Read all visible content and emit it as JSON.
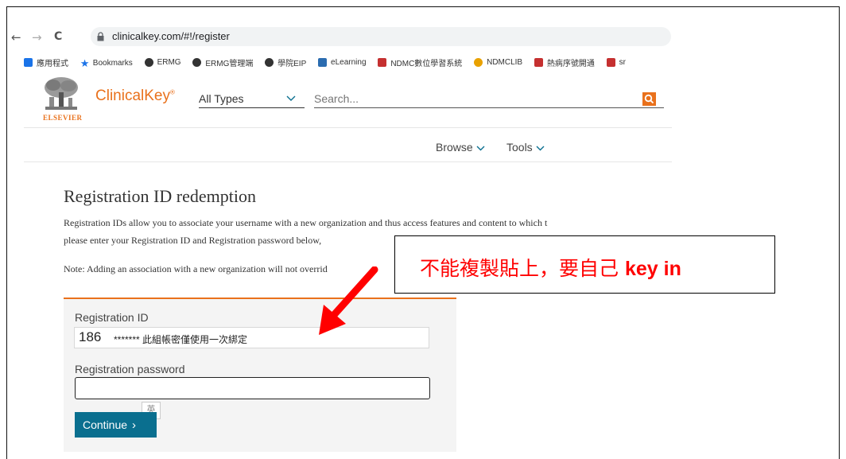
{
  "browser": {
    "back_glyph": "←",
    "forward_glyph": "→",
    "reload_glyph": "C",
    "url": "clinicalkey.com/#!/register",
    "bookmarks": [
      {
        "label": "應用程式",
        "icon": "apps-grid-icon",
        "color": "#1a73e8"
      },
      {
        "label": "Bookmarks",
        "icon": "star-icon",
        "color": "#1a73e8"
      },
      {
        "label": "ERMG",
        "icon": "globe-icon",
        "color": "#333333"
      },
      {
        "label": "ERMG管理端",
        "icon": "globe-icon",
        "color": "#333333"
      },
      {
        "label": "學院EIP",
        "icon": "globe-icon",
        "color": "#333333"
      },
      {
        "label": "eLearning",
        "icon": "elearning-icon",
        "color": "#2b6cb0"
      },
      {
        "label": "NDMC數位學習系統",
        "icon": "ndmc-icon",
        "color": "#c53030"
      },
      {
        "label": "NDMCLIB",
        "icon": "sun-icon",
        "color": "#e9a100"
      },
      {
        "label": "熱病序號開通",
        "icon": "red-bookmark-icon",
        "color": "#c53030"
      },
      {
        "label": "sr",
        "icon": "red-bookmark-icon",
        "color": "#c53030"
      }
    ]
  },
  "site": {
    "publisher": "ELSEVIER",
    "brand": "ClinicalKey",
    "brand_mark": "®",
    "type_select": "All Types",
    "search_placeholder": "Search...",
    "menu": [
      "Browse",
      "Tools"
    ],
    "accent": "#e9711c"
  },
  "page": {
    "title": "Registration ID redemption",
    "para1_line1": "Registration IDs allow you to associate your username with a new organization and thus access features and content to which t",
    "para1_line2": "please enter your Registration ID and Registration password below,",
    "note": "Note: Adding an association with a new organization will not overrid",
    "form": {
      "id_label": "Registration ID",
      "id_value": "186",
      "id_annotation": "******* 此組帳密僅使用一次綁定",
      "password_label": "Registration password",
      "password_value": "",
      "ime_indicator": "英",
      "continue_label": "Continue",
      "continue_glyph": "›",
      "button_color": "#0a6f8f"
    }
  },
  "annotation": {
    "text": "不能複製貼上，要自己",
    "text_bold": "key in",
    "color": "#ff0000"
  }
}
